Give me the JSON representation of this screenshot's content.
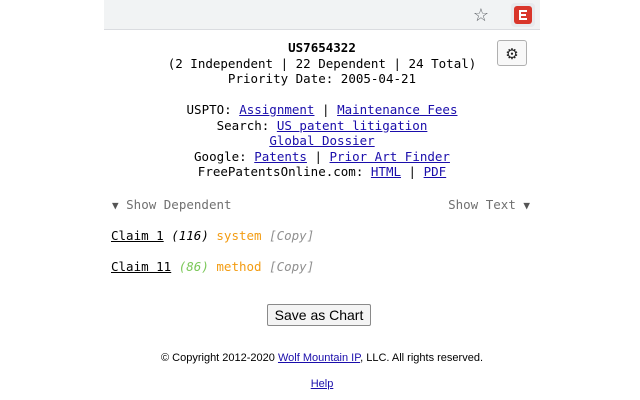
{
  "browser": {
    "star_icon": "star-icon",
    "extension_icon": "extension-icon"
  },
  "settings": {
    "gear_glyph": "⚙"
  },
  "patent": {
    "number": "US7654322",
    "counts": "(2 Independent | 22 Dependent | 24 Total)",
    "priority": "Priority Date: 2005-04-21"
  },
  "links": {
    "uspto_label": "USPTO:",
    "assignment": "Assignment",
    "maintenance_fees": "Maintenance Fees",
    "search_label": "Search:",
    "us_patent_litigation": "US patent litigation",
    "global_dossier": "Global Dossier",
    "google_label": "Google:",
    "patents": "Patents",
    "prior_art_finder": "Prior Art Finder",
    "fpo_label": "FreePatentsOnline.com:",
    "html": "HTML",
    "pdf": "PDF",
    "separator": "|"
  },
  "toggles": {
    "show_dependent": "Show Dependent",
    "show_text": "Show Text"
  },
  "claims": [
    {
      "label": "Claim 1",
      "count": "(116)",
      "word": "system",
      "copy": "[Copy]"
    },
    {
      "label": "Claim 11",
      "count": "(86)",
      "word": "method",
      "copy": "[Copy]"
    }
  ],
  "actions": {
    "save_chart": "Save as Chart"
  },
  "footer": {
    "copyright_prefix": "© Copyright 2012-2020 ",
    "company": "Wolf Mountain IP",
    "copyright_suffix": ", LLC. All rights reserved.",
    "help": "Help"
  },
  "colors": {
    "link": "#1a0dab",
    "word": "#f39c12",
    "green_count": "#7cc85a",
    "muted": "#707070"
  }
}
